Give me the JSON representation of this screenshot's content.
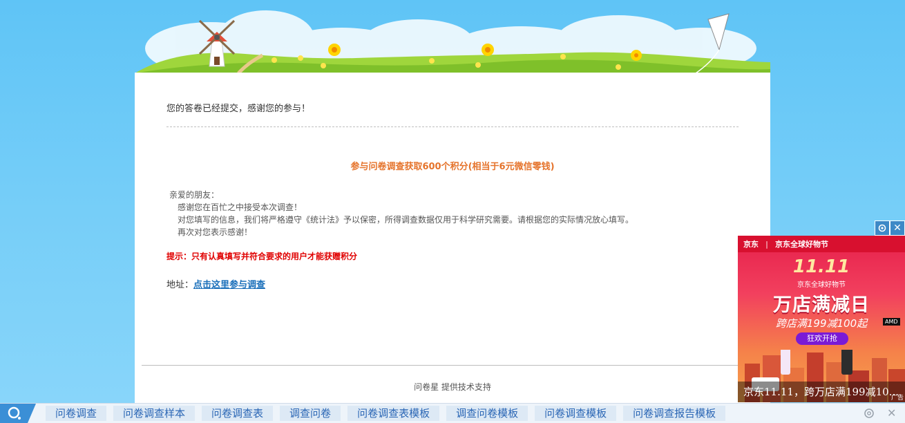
{
  "card": {
    "submitted": "您的答卷已经提交，感谢您的参与！",
    "promo_title": "参与问卷调查获取600个积分(相当于6元微信零钱)",
    "greeting": {
      "line1": "亲爱的朋友：",
      "line2": "感谢您在百忙之中接受本次调查！",
      "line3": "对您填写的信息，我们将严格遵守《统计法》予以保密，所得调查数据仅用于科学研究需要。请根据您的实际情况放心填写。",
      "line4": "再次对您表示感谢！"
    },
    "tip": "提示：只有认真填写并符合要求的用户才能获赠积分",
    "address_label": "地址：",
    "address_link": "点击这里参与调查",
    "powered_by": "问卷星 提供技术支持"
  },
  "ad": {
    "brand": "京东",
    "event_tag": "京东全球好物节",
    "big_11": "11.11",
    "festival": "京东全球好物节",
    "headline": "万店满减日",
    "subline": "跨店满199减100起",
    "button": "狂欢开抢",
    "amd": "AMD",
    "caption": "京东11.11，跨万店满199减10...",
    "ad_mark": "广告",
    "settings_icon": "gear-icon",
    "close_icon": "close-icon"
  },
  "bottombar": {
    "keywords": [
      "问卷调查",
      "问卷调查样本",
      "问卷调查表",
      "调查问卷",
      "问卷调查表模板",
      "调查问卷模板",
      "问卷调查模板",
      "问卷调查报告模板"
    ],
    "close": "✕"
  },
  "colors": {
    "sky": "#5fc4f6",
    "promo": "#e5732b",
    "tip": "#e00000",
    "link": "#1a6fba",
    "keyword": "#2a66b5"
  }
}
